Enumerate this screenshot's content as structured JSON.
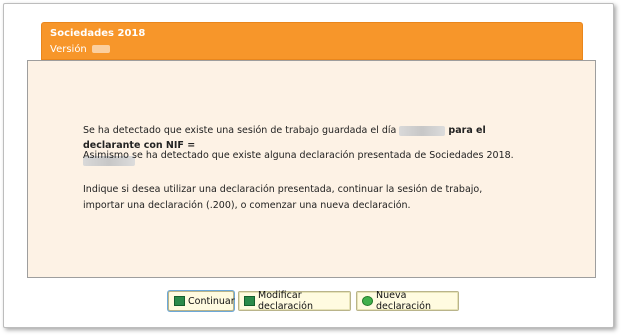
{
  "header": {
    "title": "Sociedades 2018",
    "version_label": "Versión"
  },
  "message": {
    "line1_prefix": "Se ha detectado que existe una sesión de trabajo guardada el día",
    "line1_bold": "para el declarante con NIF =",
    "line2": "Asimismo se ha detectado que existe alguna declaración presentada de Sociedades 2018.",
    "line3": "Indique si desea utilizar una declaración presentada, continuar la sesión de trabajo, importar una declaración (.200), o comenzar una nueva declaración."
  },
  "buttons": {
    "continuar": "Continuar",
    "modificar": "Modificar declaración",
    "nueva": "Nueva declaración"
  },
  "colors": {
    "header_bg": "#f7962a",
    "body_bg": "#fdf2e5",
    "button_bg": "#fffbe0"
  },
  "icons": {
    "continuar": "document-icon",
    "modificar": "document-icon",
    "nueva": "go-icon"
  }
}
